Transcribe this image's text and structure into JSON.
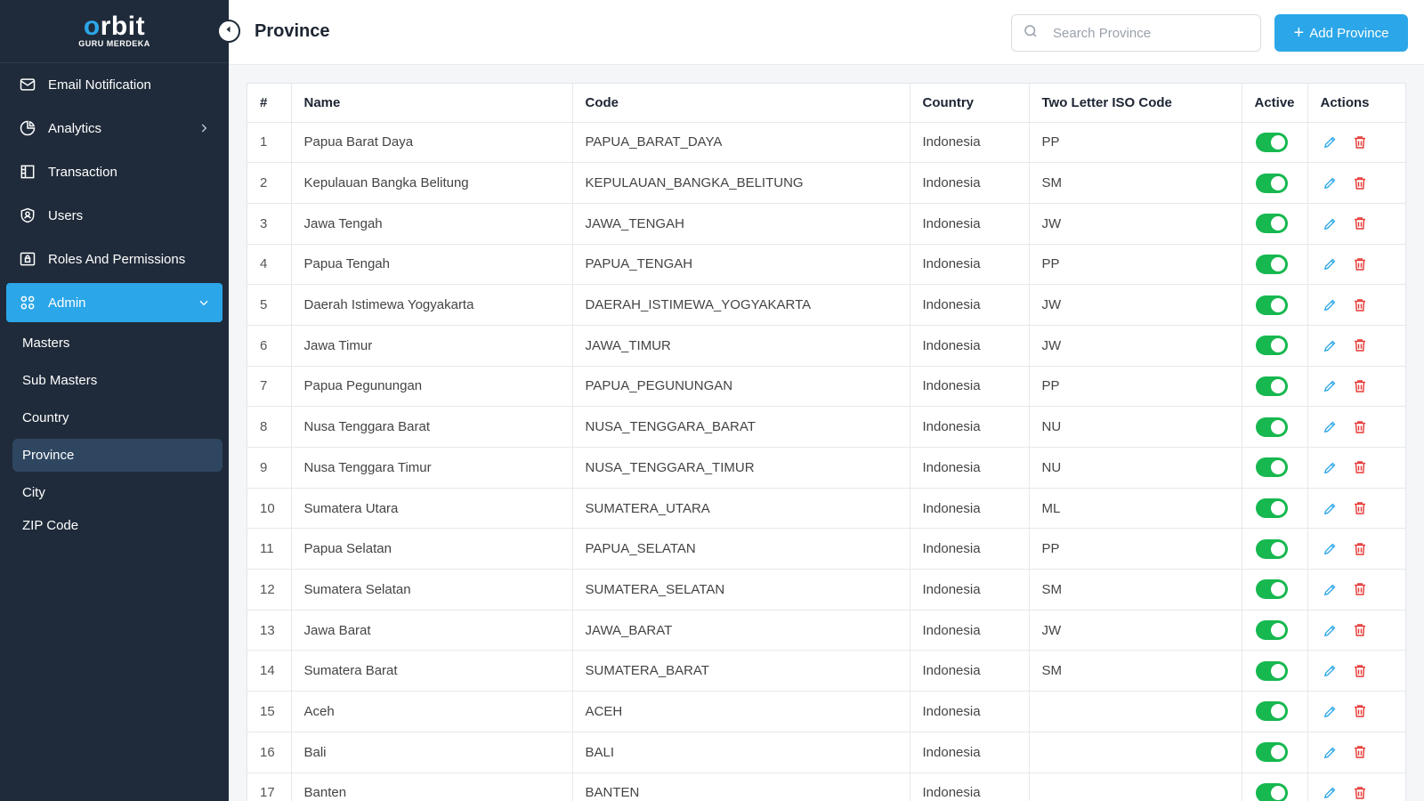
{
  "logo": {
    "main": "orbit",
    "sub": "GURU MERDEKA"
  },
  "sidebar": {
    "items": [
      {
        "label": "Email Notification",
        "icon": "mail-icon"
      },
      {
        "label": "Analytics",
        "icon": "pie-chart-icon"
      },
      {
        "label": "Transaction",
        "icon": "receipt-icon"
      },
      {
        "label": "Users",
        "icon": "shield-user-icon"
      },
      {
        "label": "Roles And Permissions",
        "icon": "lock-folder-icon"
      },
      {
        "label": "Admin",
        "icon": "grid-icon"
      }
    ],
    "admin_sub": [
      {
        "label": "Masters"
      },
      {
        "label": "Sub Masters"
      },
      {
        "label": "Country"
      },
      {
        "label": "Province"
      },
      {
        "label": "City"
      },
      {
        "label": "ZIP Code"
      }
    ]
  },
  "header": {
    "title": "Province",
    "search_placeholder": "Search Province",
    "add_label": "Add Province"
  },
  "table": {
    "columns": [
      "#",
      "Name",
      "Code",
      "Country",
      "Two Letter ISO Code",
      "Active",
      "Actions"
    ],
    "rows": [
      {
        "num": "1",
        "name": "Papua Barat Daya",
        "code": "PAPUA_BARAT_DAYA",
        "country": "Indonesia",
        "iso": "PP",
        "active": true
      },
      {
        "num": "2",
        "name": "Kepulauan Bangka Belitung",
        "code": "KEPULAUAN_BANGKA_BELITUNG",
        "country": "Indonesia",
        "iso": "SM",
        "active": true
      },
      {
        "num": "3",
        "name": "Jawa Tengah",
        "code": "JAWA_TENGAH",
        "country": "Indonesia",
        "iso": "JW",
        "active": true
      },
      {
        "num": "4",
        "name": "Papua Tengah",
        "code": "PAPUA_TENGAH",
        "country": "Indonesia",
        "iso": "PP",
        "active": true
      },
      {
        "num": "5",
        "name": "Daerah Istimewa Yogyakarta",
        "code": "DAERAH_ISTIMEWA_YOGYAKARTA",
        "country": "Indonesia",
        "iso": "JW",
        "active": true
      },
      {
        "num": "6",
        "name": "Jawa Timur",
        "code": "JAWA_TIMUR",
        "country": "Indonesia",
        "iso": "JW",
        "active": true
      },
      {
        "num": "7",
        "name": "Papua Pegunungan",
        "code": "PAPUA_PEGUNUNGAN",
        "country": "Indonesia",
        "iso": "PP",
        "active": true
      },
      {
        "num": "8",
        "name": "Nusa Tenggara Barat",
        "code": "NUSA_TENGGARA_BARAT",
        "country": "Indonesia",
        "iso": "NU",
        "active": true
      },
      {
        "num": "9",
        "name": "Nusa Tenggara Timur",
        "code": "NUSA_TENGGARA_TIMUR",
        "country": "Indonesia",
        "iso": "NU",
        "active": true
      },
      {
        "num": "10",
        "name": "Sumatera Utara",
        "code": "SUMATERA_UTARA",
        "country": "Indonesia",
        "iso": "ML",
        "active": true
      },
      {
        "num": "11",
        "name": "Papua Selatan",
        "code": "PAPUA_SELATAN",
        "country": "Indonesia",
        "iso": "PP",
        "active": true
      },
      {
        "num": "12",
        "name": "Sumatera Selatan",
        "code": "SUMATERA_SELATAN",
        "country": "Indonesia",
        "iso": "SM",
        "active": true
      },
      {
        "num": "13",
        "name": "Jawa Barat",
        "code": "JAWA_BARAT",
        "country": "Indonesia",
        "iso": "JW",
        "active": true
      },
      {
        "num": "14",
        "name": "Sumatera Barat",
        "code": "SUMATERA_BARAT",
        "country": "Indonesia",
        "iso": "SM",
        "active": true
      },
      {
        "num": "15",
        "name": "Aceh",
        "code": "ACEH",
        "country": "Indonesia",
        "iso": "",
        "active": true
      },
      {
        "num": "16",
        "name": "Bali",
        "code": "BALI",
        "country": "Indonesia",
        "iso": "",
        "active": true
      },
      {
        "num": "17",
        "name": "Banten",
        "code": "BANTEN",
        "country": "Indonesia",
        "iso": "",
        "active": true
      }
    ]
  },
  "colors": {
    "accent": "#2ba6e8",
    "sidebar": "#1f2b3a",
    "active_toggle": "#16b84f",
    "delete": "#e53935"
  }
}
